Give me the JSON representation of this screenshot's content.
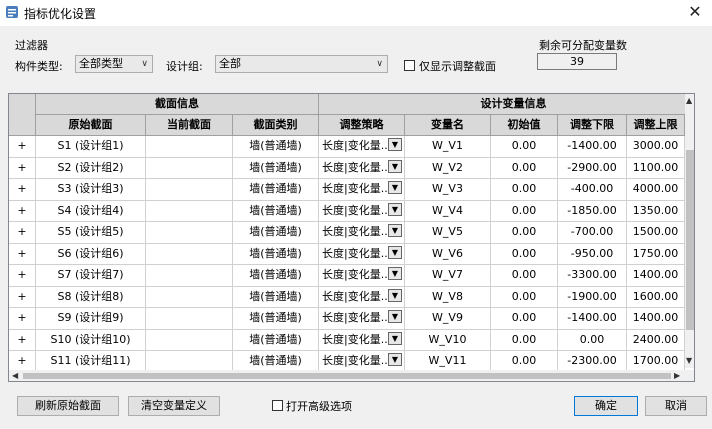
{
  "window": {
    "title": "指标优化设置",
    "close_glyph": "✕"
  },
  "filter": {
    "group_label": "过滤器",
    "component_type_label": "构件类型:",
    "component_type_value": "全部类型",
    "design_group_label": "设计组:",
    "design_group_value": "全部",
    "only_show_adjusted_label": "仅显示调整截面",
    "only_show_adjusted_checked": false
  },
  "remaining": {
    "label": "剩余可分配变量数",
    "value": "39"
  },
  "grid": {
    "group_headers": [
      "截面信息",
      "设计变量信息"
    ],
    "columns": [
      "原始截面",
      "当前截面",
      "截面类别",
      "调整策略",
      "变量名",
      "初始值",
      "调整下限",
      "调整上限"
    ],
    "rows": [
      {
        "expand": "+",
        "original": "S1 (设计组1)",
        "current": "",
        "category": "墙(普通墙)",
        "strategy": "长度|变化量...",
        "var": "W_V1",
        "init": "0.00",
        "lower": "-1400.00",
        "upper": "3000.00"
      },
      {
        "expand": "+",
        "original": "S2 (设计组2)",
        "current": "",
        "category": "墙(普通墙)",
        "strategy": "长度|变化量...",
        "var": "W_V2",
        "init": "0.00",
        "lower": "-2900.00",
        "upper": "1100.00"
      },
      {
        "expand": "+",
        "original": "S3 (设计组3)",
        "current": "",
        "category": "墙(普通墙)",
        "strategy": "长度|变化量...",
        "var": "W_V3",
        "init": "0.00",
        "lower": "-400.00",
        "upper": "4000.00"
      },
      {
        "expand": "+",
        "original": "S4 (设计组4)",
        "current": "",
        "category": "墙(普通墙)",
        "strategy": "长度|变化量...",
        "var": "W_V4",
        "init": "0.00",
        "lower": "-1850.00",
        "upper": "1350.00"
      },
      {
        "expand": "+",
        "original": "S5 (设计组5)",
        "current": "",
        "category": "墙(普通墙)",
        "strategy": "长度|变化量...",
        "var": "W_V5",
        "init": "0.00",
        "lower": "-700.00",
        "upper": "1500.00"
      },
      {
        "expand": "+",
        "original": "S6 (设计组6)",
        "current": "",
        "category": "墙(普通墙)",
        "strategy": "长度|变化量...",
        "var": "W_V6",
        "init": "0.00",
        "lower": "-950.00",
        "upper": "1750.00"
      },
      {
        "expand": "+",
        "original": "S7 (设计组7)",
        "current": "",
        "category": "墙(普通墙)",
        "strategy": "长度|变化量...",
        "var": "W_V7",
        "init": "0.00",
        "lower": "-3300.00",
        "upper": "1400.00"
      },
      {
        "expand": "+",
        "original": "S8 (设计组8)",
        "current": "",
        "category": "墙(普通墙)",
        "strategy": "长度|变化量...",
        "var": "W_V8",
        "init": "0.00",
        "lower": "-1900.00",
        "upper": "1600.00"
      },
      {
        "expand": "+",
        "original": "S9 (设计组9)",
        "current": "",
        "category": "墙(普通墙)",
        "strategy": "长度|变化量...",
        "var": "W_V9",
        "init": "0.00",
        "lower": "-1400.00",
        "upper": "1400.00"
      },
      {
        "expand": "+",
        "original": "S10 (设计组10)",
        "current": "",
        "category": "墙(普通墙)",
        "strategy": "长度|变化量...",
        "var": "W_V10",
        "init": "0.00",
        "lower": "0.00",
        "upper": "2400.00"
      },
      {
        "expand": "+",
        "original": "S11 (设计组11)",
        "current": "",
        "category": "墙(普通墙)",
        "strategy": "长度|变化量...",
        "var": "W_V11",
        "init": "0.00",
        "lower": "-2300.00",
        "upper": "1700.00"
      }
    ]
  },
  "buttons": {
    "refresh": "刷新原始截面",
    "clear": "清空变量定义",
    "advanced_label": "打开高级选项",
    "advanced_checked": false,
    "ok": "确定",
    "cancel": "取消"
  }
}
